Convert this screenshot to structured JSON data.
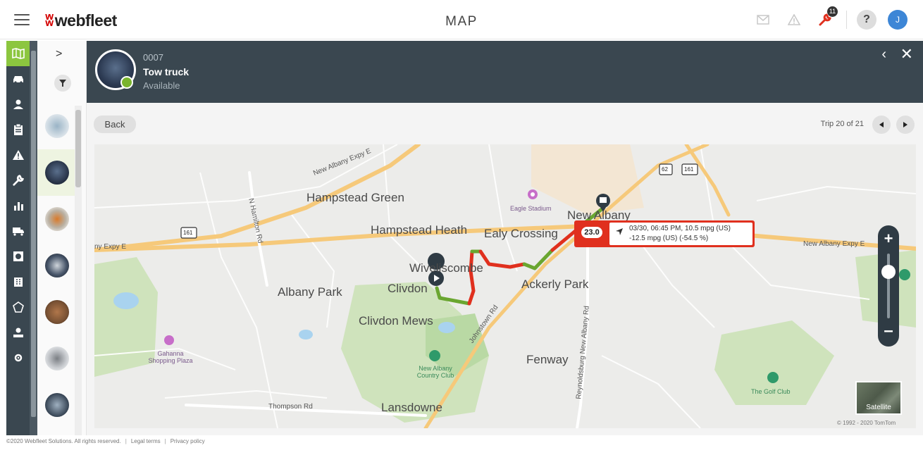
{
  "app": {
    "brand": "webfleet",
    "page_title": "MAP"
  },
  "topbar": {
    "notification_count": "11",
    "help_label": "?",
    "user_initial": "J"
  },
  "vehicle": {
    "id": "0007",
    "name": "Tow truck",
    "status": "Available"
  },
  "trip": {
    "back_label": "Back",
    "label": "Trip 20 of 21"
  },
  "tooltip": {
    "speed": "23.0",
    "line1": "03/30, 06:45 PM, 10.5 mpg (US)",
    "line2": "-12.5 mpg (US) (-54.5 %)"
  },
  "map": {
    "labels": {
      "hampstead_green": "Hampstead Green",
      "hampstead_heath": "Hampstead Heath",
      "ealy_crossing": "Ealy Crossing",
      "new_albany": "New Albany",
      "wiveliscombe": "Wiveliscombe",
      "clivdon": "Clivdon",
      "albany_park": "Albany Park",
      "ackerly_park": "Ackerly Park",
      "clivdon_mews": "Clivdon Mews",
      "fenway": "Fenway",
      "lansdowne": "Lansdowne"
    },
    "small_labels": {
      "new_albany_expy_top": "New Albany Expy E",
      "new_albany_expy_right": "New Albany Expy E",
      "expy_left": "ny Expy E",
      "n_hamilton": "N Hamilton Rd",
      "johnstown": "Johnstown Rd",
      "reynoldsburg": "Reynoldsburg New Albany Rd",
      "thompson": "Thompson Rd",
      "eagle_stadium": "Eagle Stadium",
      "gahanna": "Gahanna Shopping Plaza",
      "country_club": "New Albany Country Club",
      "golf_club": "The Golf Club",
      "route_161_left": "161",
      "route_161_right": "161",
      "route_62": "62"
    },
    "satellite_label": "Satellite",
    "attribution": "© 1992 - 2020 TomTom"
  },
  "footer": {
    "copyright": "©2020 Webfleet Solutions. All rights reserved.",
    "legal": "Legal terms",
    "privacy": "Privacy policy"
  },
  "colors": {
    "nav_bg": "#3a4750",
    "accent_green": "#8cc63f",
    "route_red": "#e0301e",
    "route_green": "#6aa630",
    "tooltip_red": "#e0301e",
    "user_avatar": "#3d86d6"
  }
}
